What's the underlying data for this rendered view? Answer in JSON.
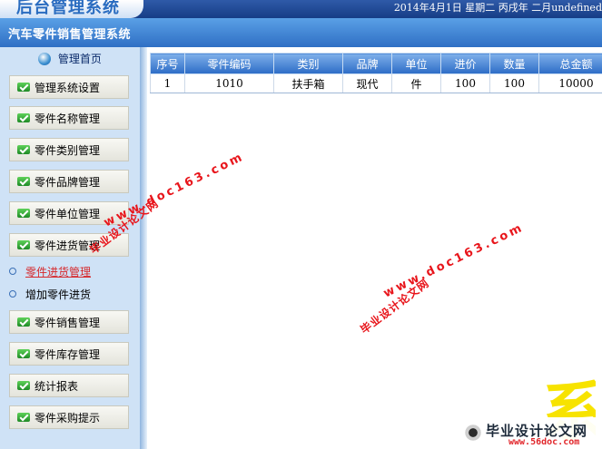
{
  "header": {
    "logo": "后台管理系统",
    "date": "2014年4月1日 星期二 丙戌年 二月undefined"
  },
  "system_title": "汽车零件销售管理系统",
  "sidebar": {
    "home": "管理首页",
    "items": [
      "管理系统设置",
      "零件名称管理",
      "零件类别管理",
      "零件品牌管理",
      "零件单位管理",
      "零件进货管理"
    ],
    "sub_items": [
      {
        "label": "零件进货管理",
        "active": true
      },
      {
        "label": "增加零件进货",
        "active": false
      }
    ],
    "items_after": [
      "零件销售管理",
      "零件库存管理",
      "统计报表",
      "零件采购提示"
    ]
  },
  "table": {
    "columns": [
      "序号",
      "零件编码",
      "类别",
      "品牌",
      "单位",
      "进价",
      "数量",
      "总金额"
    ],
    "rows": [
      [
        "1",
        "1010",
        "扶手箱",
        "现代",
        "件",
        "100",
        "100",
        "10000"
      ]
    ]
  },
  "watermark": {
    "site": "www.doc163.com",
    "text": "毕业设计论文网",
    "badge_title": "毕业设计论文网",
    "badge_url": "www.56doc.com"
  },
  "colors": {
    "header_bg": "#163d86",
    "title_bar": "#2f6fc4",
    "sidebar_bg": "#cfe2f6",
    "table_header": "#2c6cc6",
    "watermark": "#e8151b",
    "active_link": "#d6282b"
  }
}
